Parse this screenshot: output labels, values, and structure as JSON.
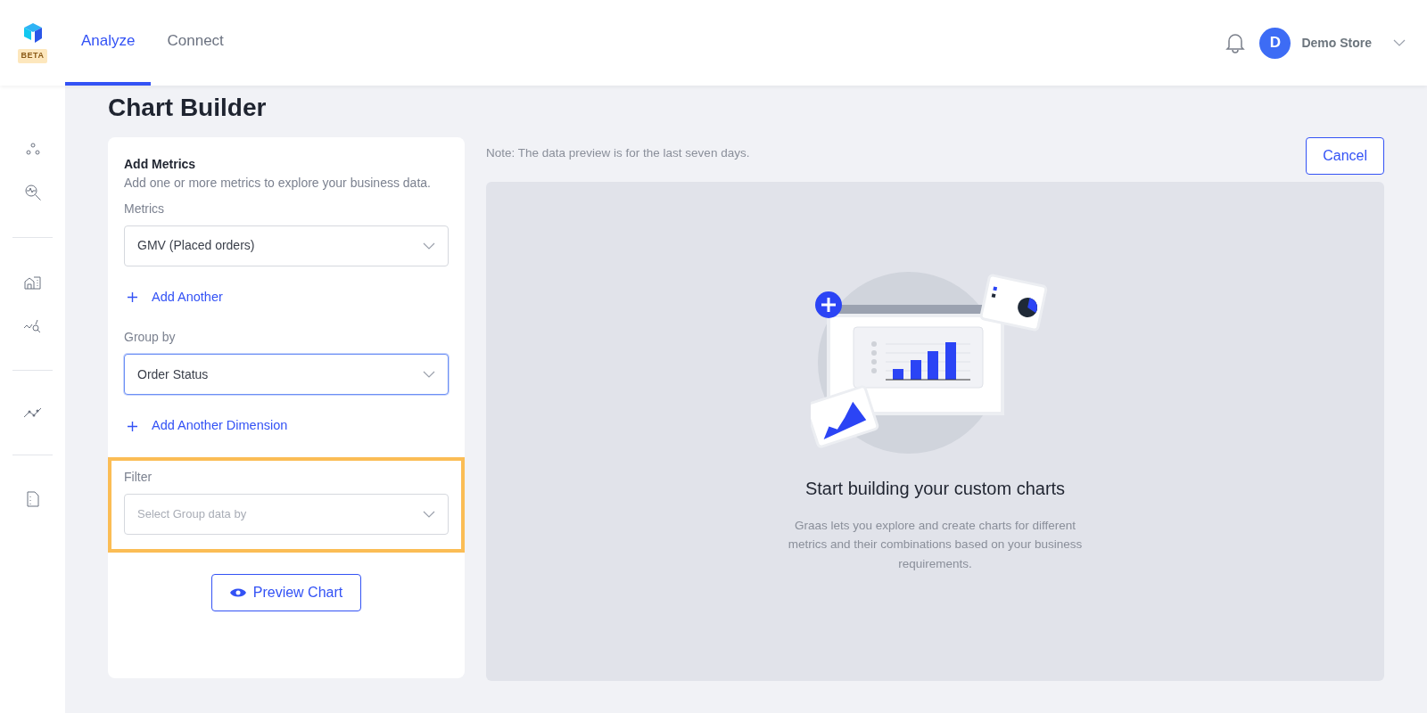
{
  "header": {
    "logo_badge": "BETA",
    "tabs": [
      {
        "label": "Analyze",
        "selected": true
      },
      {
        "label": "Connect",
        "selected": false
      }
    ],
    "user": {
      "avatar_initial": "D",
      "name": "Demo Store"
    }
  },
  "page_title": "Chart Builder",
  "builder": {
    "title": "Add Metrics",
    "subtitle": "Add one or more metrics to explore your business data.",
    "fields": [
      {
        "label": "Metrics",
        "value": "GMV (Placed orders)",
        "focused": false,
        "highlighted": false,
        "add_link": "Add Another"
      },
      {
        "label": "Group by",
        "value": "Order Status",
        "focused": true,
        "highlighted": false,
        "add_link": "Add Another Dimension"
      },
      {
        "label": "Filter",
        "placeholder": "Select Group data by",
        "focused": false,
        "highlighted": true
      }
    ],
    "preview_button": "Preview Chart"
  },
  "note": "Note: The data preview is for the last seven days.",
  "cancel_button": "Cancel",
  "empty_state": {
    "title": "Start building your custom charts",
    "description": "Graas lets you explore and create charts for different metrics and their combinations based on your business requirements."
  }
}
